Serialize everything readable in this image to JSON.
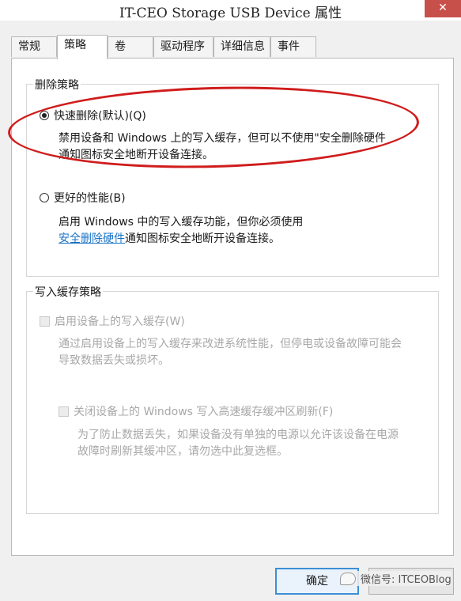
{
  "window": {
    "title": "IT-CEO Storage USB Device 属性",
    "close_glyph": "✕"
  },
  "tabs": [
    {
      "label": "常规"
    },
    {
      "label": "策略"
    },
    {
      "label": "卷"
    },
    {
      "label": "驱动程序"
    },
    {
      "label": "详细信息"
    },
    {
      "label": "事件"
    }
  ],
  "removal_policy": {
    "legend": "删除策略",
    "quick_removal": {
      "label": "快速删除(默认)(Q)",
      "checked": true,
      "desc_line1": "禁用设备和 Windows 上的写入缓存，但可以不使用\"安全删除硬件",
      "desc_line2": "通知图标安全地断开设备连接。"
    },
    "better_performance": {
      "label": "更好的性能(B)",
      "checked": false,
      "desc_line1": "启用 Windows 中的写入缓存功能，但你必须使用",
      "desc_link": "安全删除硬件",
      "desc_line2_rest": "通知图标安全地断开设备连接。"
    }
  },
  "write_cache_policy": {
    "legend": "写入缓存策略",
    "enable_cache": {
      "label": "启用设备上的写入缓存(W)",
      "desc_line1": "通过启用设备上的写入缓存来改进系统性能，但停电或设备故障可能会",
      "desc_line2": "导致数据丢失或损坏。"
    },
    "flush_off": {
      "label": "关闭设备上的 Windows 写入高速缓存缓冲区刷新(F)",
      "desc_line1": "为了防止数据丢失，如果设备没有单独的电源以允许该设备在电源",
      "desc_line2": "故障时刷新其缓冲区，请勿选中此复选框。"
    }
  },
  "buttons": {
    "ok": "确定"
  },
  "watermark": {
    "text": "微信号: ITCEOBlog"
  }
}
